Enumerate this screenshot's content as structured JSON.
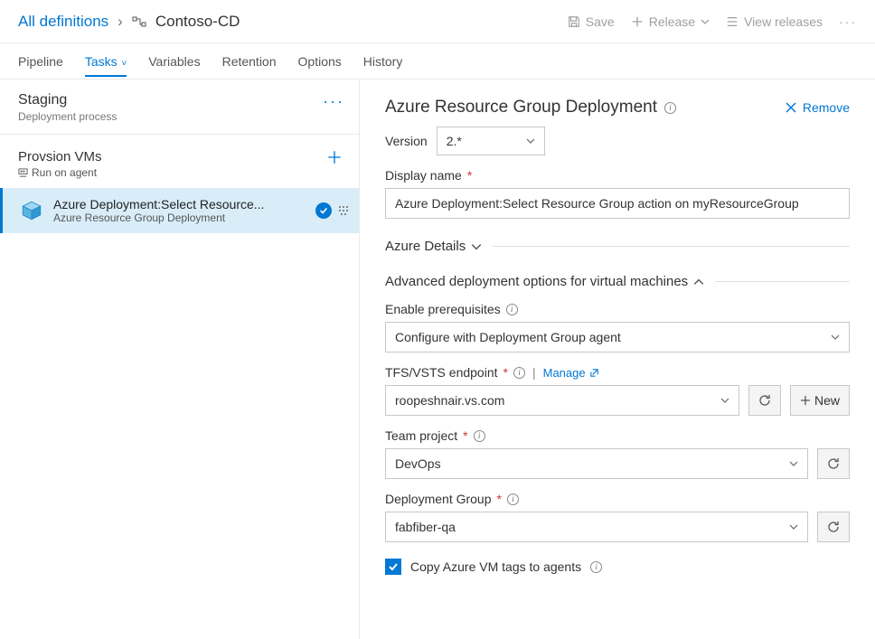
{
  "breadcrumb": {
    "root": "All definitions",
    "name": "Contoso-CD"
  },
  "topActions": {
    "save": "Save",
    "release": "Release",
    "viewReleases": "View releases"
  },
  "tabs": {
    "pipeline": "Pipeline",
    "tasks": "Tasks",
    "variables": "Variables",
    "retention": "Retention",
    "options": "Options",
    "history": "History"
  },
  "stage": {
    "title": "Staging",
    "subtitle": "Deployment process"
  },
  "phase": {
    "title": "Provsion VMs",
    "subtitle": "Run on agent"
  },
  "task": {
    "title": "Azure Deployment:Select Resource...",
    "subtitle": "Azure Resource Group Deployment"
  },
  "pane": {
    "title": "Azure Resource Group Deployment",
    "removeLabel": "Remove",
    "versionLabel": "Version",
    "versionValue": "2.*",
    "displayNameLabel": "Display name",
    "displayNameValue": "Azure Deployment:Select Resource Group action on myResourceGroup",
    "azureDetails": "Azure Details",
    "advancedHeader": "Advanced deployment options for virtual machines",
    "enablePrereqLabel": "Enable prerequisites",
    "enablePrereqValue": "Configure with Deployment Group agent",
    "endpointLabel": "TFS/VSTS endpoint",
    "manageLabel": "Manage",
    "endpointValue": "roopeshnair.vs.com",
    "newLabel": "New",
    "teamProjectLabel": "Team project",
    "teamProjectValue": "DevOps",
    "deploymentGroupLabel": "Deployment Group",
    "deploymentGroupValue": "fabfiber-qa",
    "copyTagsLabel": "Copy Azure VM tags to agents"
  }
}
